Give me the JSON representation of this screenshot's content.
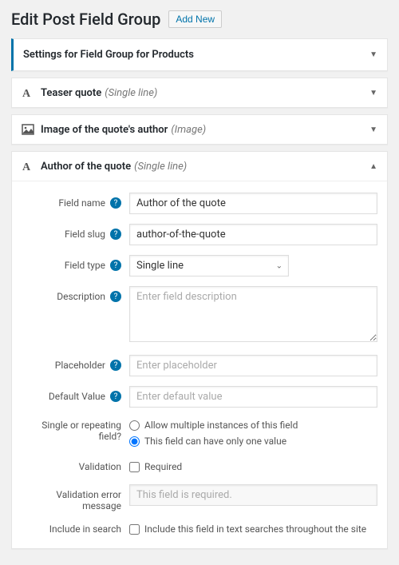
{
  "header": {
    "title": "Edit Post Field Group",
    "add_new": "Add New"
  },
  "panels": {
    "settings": {
      "title": "Settings for Field Group for Products"
    },
    "teaser": {
      "title": "Teaser quote",
      "type": "(Single line)"
    },
    "image": {
      "title": "Image of the quote's author",
      "type": "(Image)"
    },
    "author": {
      "title": "Author of the quote",
      "type": "(Single line)"
    }
  },
  "form": {
    "field_name": {
      "label": "Field name",
      "value": "Author of the quote"
    },
    "field_slug": {
      "label": "Field slug",
      "value": "author-of-the-quote"
    },
    "field_type": {
      "label": "Field type",
      "value": "Single line"
    },
    "description": {
      "label": "Description",
      "placeholder": "Enter field description"
    },
    "placeholder": {
      "label": "Placeholder",
      "placeholder": "Enter placeholder"
    },
    "default_val": {
      "label": "Default Value",
      "placeholder": "Enter default value"
    },
    "repeating": {
      "label": "Single or repeating field?",
      "opt_multi": "Allow multiple instances of this field",
      "opt_single": "This field can have only one value"
    },
    "validation": {
      "label": "Validation",
      "required": "Required"
    },
    "validation_msg": {
      "label": "Validation error message",
      "value": "This field is required."
    },
    "include_search": {
      "label": "Include in search",
      "text": "Include this field in text searches throughout the site"
    }
  }
}
